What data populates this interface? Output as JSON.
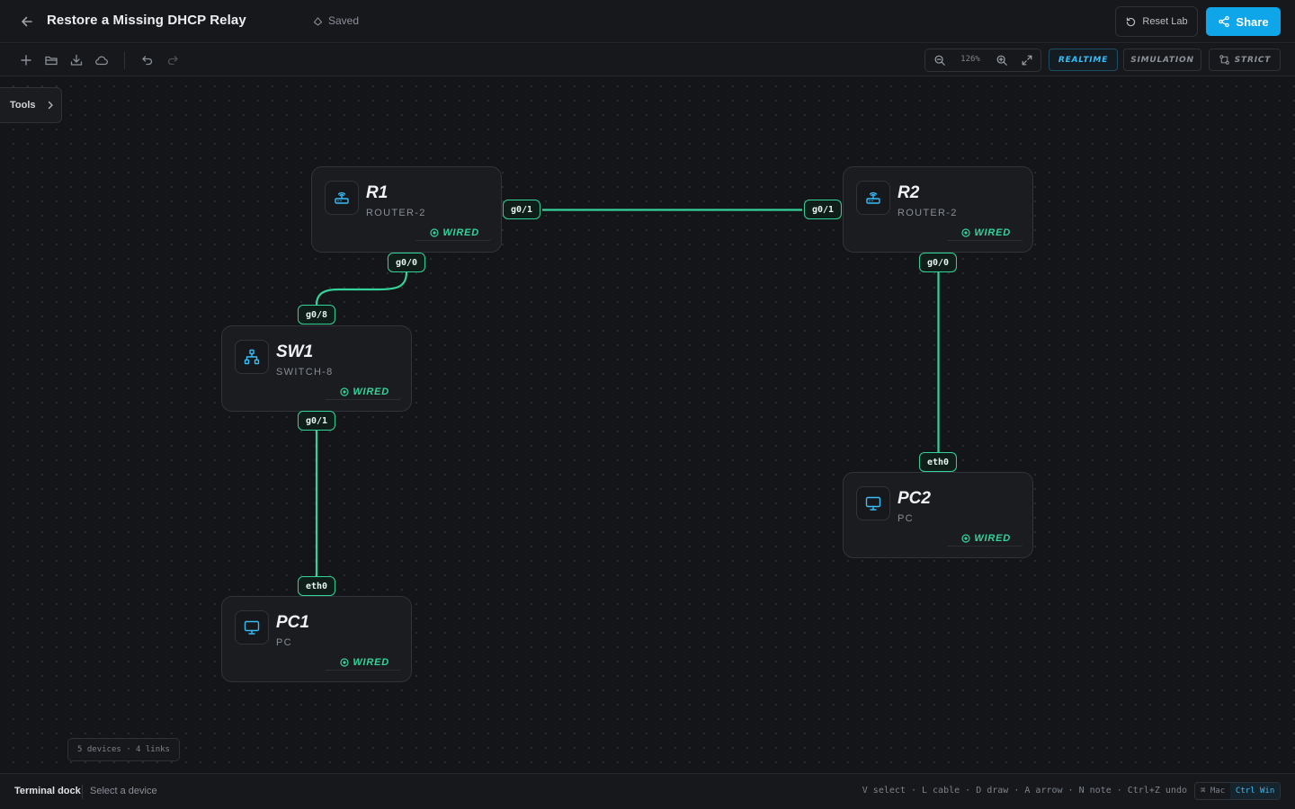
{
  "header": {
    "title": "Restore a Missing DHCP Relay",
    "save_status": "Saved",
    "reset_label": "Reset Lab",
    "share_label": "Share"
  },
  "toolbar": {
    "zoom_level": "126%",
    "modes": [
      {
        "label": "REALTIME",
        "active": true
      },
      {
        "label": "SIMULATION",
        "active": false
      },
      {
        "label": "STRICT",
        "active": false
      }
    ],
    "icons": [
      "add-icon",
      "open-folder-icon",
      "download-icon",
      "cloud-icon",
      "undo-icon",
      "redo-icon"
    ]
  },
  "canvas": {
    "tools_label": "Tools",
    "stats": "5 devices · 4 links",
    "nodes": {
      "r1": {
        "name": "R1",
        "type": "ROUTER-2",
        "status": "WIRED",
        "icon": "router-icon"
      },
      "r2": {
        "name": "R2",
        "type": "ROUTER-2",
        "status": "WIRED",
        "icon": "router-icon"
      },
      "sw1": {
        "name": "SW1",
        "type": "SWITCH-8",
        "status": "WIRED",
        "icon": "switch-icon"
      },
      "pc1": {
        "name": "PC1",
        "type": "PC",
        "status": "WIRED",
        "icon": "monitor-icon"
      },
      "pc2": {
        "name": "PC2",
        "type": "PC",
        "status": "WIRED",
        "icon": "monitor-icon"
      }
    },
    "ports": {
      "r1_g01": "g0/1",
      "r2_g01": "g0/1",
      "r1_g00": "g0/0",
      "sw1_g08": "g0/8",
      "sw1_g01": "g0/1",
      "pc1_eth0": "eth0",
      "r2_g00": "g0/0",
      "pc2_eth0": "eth0"
    }
  },
  "footer": {
    "dock_label": "Terminal dock",
    "dock_hint": "Select a device",
    "shortcuts": "V select · L cable · D draw · A arrow · N note · Ctrl+Z undo",
    "os_mac": "⌘ Mac",
    "os_win": "Ctrl Win"
  },
  "colors": {
    "accent": "#0ea5e9",
    "link": "#34d399",
    "background": "#141518"
  }
}
